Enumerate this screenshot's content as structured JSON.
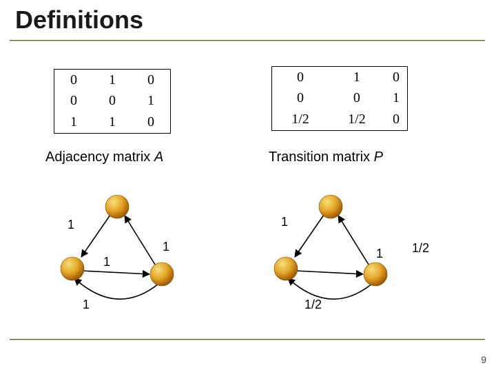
{
  "title": "Definitions",
  "page_number": "9",
  "matrixA": {
    "caption_prefix": "Adjacency matrix ",
    "caption_name": "A",
    "rows": [
      [
        "0",
        "1",
        "0"
      ],
      [
        "0",
        "0",
        "1"
      ],
      [
        "1",
        "1",
        "0"
      ]
    ]
  },
  "matrixP": {
    "caption_prefix": "Transition matrix ",
    "caption_name": "P",
    "rows": [
      [
        "0",
        "1",
        "0"
      ],
      [
        "0",
        "0",
        "1"
      ],
      [
        "1/2",
        "1/2",
        "0"
      ]
    ]
  },
  "graphA": {
    "edges": {
      "top_left": "1",
      "mid_right": "1",
      "mid_left": "1",
      "bottom_left": "1"
    }
  },
  "graphP": {
    "edges": {
      "top_left": "1",
      "mid_right": "1",
      "far_right": "1/2",
      "bottom": "1/2"
    }
  }
}
